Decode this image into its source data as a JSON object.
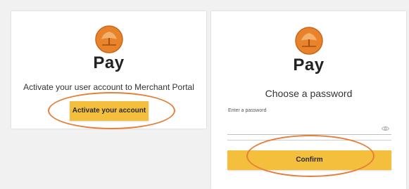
{
  "activate_card": {
    "brand": "Pay",
    "message": "Activate your user account to Merchant Portal",
    "button_label": "Activate your account"
  },
  "password_card": {
    "brand": "Pay",
    "heading": "Choose a password",
    "field_label": "Enter a password",
    "password_value": "",
    "button_label": "Confirm"
  },
  "colors": {
    "button": "#f5bf3e",
    "highlight_ring": "#e57f3a",
    "logo_orange": "#e8832b"
  },
  "icons": {
    "logo": "tree-logo-icon",
    "visibility": "eye-icon"
  }
}
